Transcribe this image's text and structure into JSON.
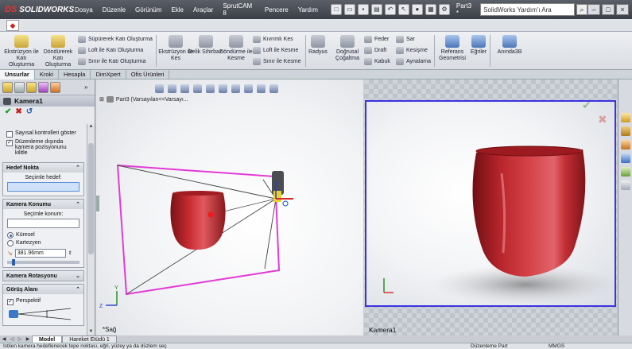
{
  "app": {
    "brand": "SOLIDWORKS",
    "brand_prefix": "DS",
    "doc_title": "Part3 *"
  },
  "menu": [
    "Dosya",
    "Düzenle",
    "Görünüm",
    "Ekle",
    "Araçlar",
    "SprutCAM 8",
    "Pencere",
    "Yardım"
  ],
  "search": {
    "placeholder": "SolidWorks Yardım'ı Ara"
  },
  "ribbon": {
    "extrude_boss": "Ekstrüzyon ile Katı Oluşturma",
    "revolve_boss": "Döndürerek Katı Oluşturma",
    "sweep_boss": "Süpürerek Katı Oluşturma",
    "loft_boss": "Loft ile Katı Oluşturma",
    "boundary_boss": "Sınır ile Katı Oluşturma",
    "extrude_cut": "Ekstrüzyon ile Kes",
    "hole_wizard": "Delik Sihirbazı",
    "revolve_cut": "Döndürme ile Kesme",
    "swept_cut": "Kıvrımlı Kes",
    "loft_cut": "Loft ile Kesme",
    "boundary_cut": "Sınır ile Kesme",
    "fillet": "Radyus",
    "linear_pattern": "Doğrusal Çoğaltma",
    "rib": "Feder",
    "draft": "Draft",
    "shell": "Kabuk",
    "wrap": "Sar",
    "intersect": "Kesişme",
    "mirror": "Aynalama",
    "ref_geometry": "Referans Geometrisi",
    "curves": "Eğriler",
    "instant3d": "Anında3B"
  },
  "tabs": [
    "Unsurlar",
    "Kroki",
    "Hesapla",
    "DimXpert",
    "Ofis Ürünleri"
  ],
  "pm": {
    "title": "Kamera1",
    "numeric_controls": "Sayısal kontrolleri göster",
    "lock_camera": "Düzenleme dışında kamera pozisyonunu kilitle",
    "target_group": "Hedef Nokta",
    "target_label": "Seçimle hedef:",
    "position_group": "Kamera Konumu",
    "position_label": "Seçimle konum:",
    "spherical": "Küresel",
    "cartesian": "Kartezyen",
    "distance": "381.96mm",
    "rotation_group": "Kamera Rotasyonu",
    "fov_group": "Görüş Alanı",
    "perspective": "Perspektif"
  },
  "viewport_left": {
    "tree_text": "Part3 (Varsayılan<<Varsayı...",
    "view_label": "*Sağ"
  },
  "viewport_right": {
    "label": "Kamera1"
  },
  "bottom_tabs": [
    "Model",
    "Hareket Etüdü 1"
  ],
  "status": {
    "hint": "İstilen kamera hedeflenecek tepe noktası, eğri, yüzey ya da düzlem seç",
    "mode": "Düzenleme Part",
    "extra": "MMGS"
  },
  "colors": {
    "cup": "#b3232a",
    "camera_frame": "#e23ad6",
    "camera_view_border": "#3d31e0"
  }
}
